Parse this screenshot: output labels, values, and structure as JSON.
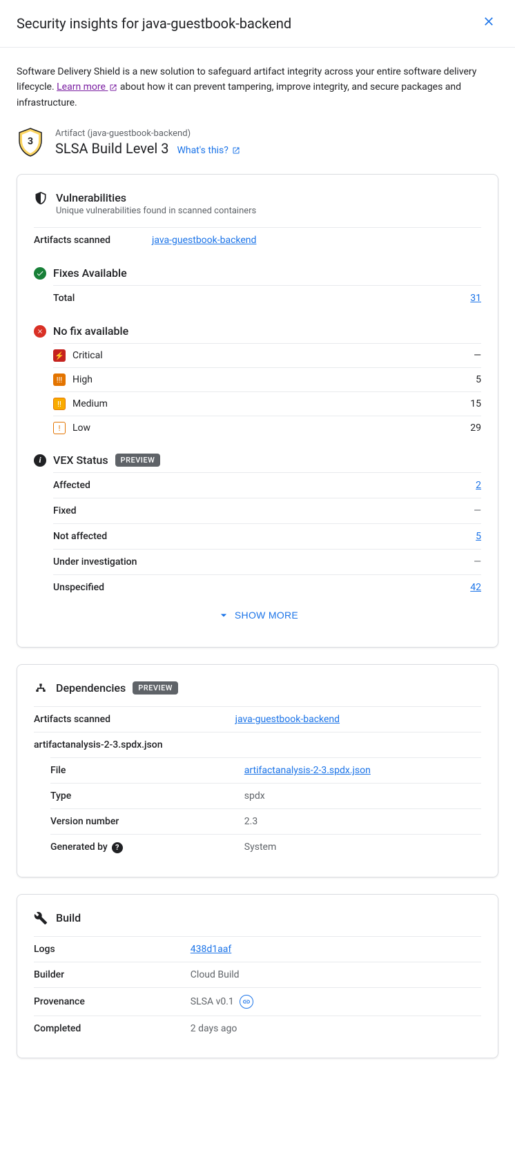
{
  "header": {
    "title": "Security insights for java-guestbook-backend"
  },
  "intro": {
    "text1": "Software Delivery Shield is a new solution to safeguard artifact integrity across your entire software delivery lifecycle. ",
    "learn": "Learn more",
    "text2": " about how it can prevent tampering, improve integrity, and secure packages and infrastructure."
  },
  "artifact": {
    "label": "Artifact (java-guestbook-backend)",
    "slsa": "SLSA Build Level 3",
    "whats_this": "What's this?",
    "badge_number": "3"
  },
  "vuln": {
    "title": "Vulnerabilities",
    "subtitle": "Unique vulnerabilities found in scanned containers",
    "scanned_label": "Artifacts scanned",
    "scanned_value": "java-guestbook-backend",
    "fixes": {
      "title": "Fixes Available",
      "total_label": "Total",
      "total_value": "31"
    },
    "nofix": {
      "title": "No fix available",
      "rows": [
        {
          "name": "Critical",
          "value": "—",
          "link": false
        },
        {
          "name": "High",
          "value": "5",
          "link": true
        },
        {
          "name": "Medium",
          "value": "15",
          "link": true
        },
        {
          "name": "Low",
          "value": "29",
          "link": true
        }
      ]
    },
    "vex": {
      "title": "VEX Status",
      "preview": "PREVIEW",
      "rows": [
        {
          "name": "Affected",
          "value": "2",
          "link": true
        },
        {
          "name": "Fixed",
          "value": "—",
          "link": false
        },
        {
          "name": "Not affected",
          "value": "5",
          "link": true
        },
        {
          "name": "Under investigation",
          "value": "—",
          "link": false
        },
        {
          "name": "Unspecified",
          "value": "42",
          "link": true
        }
      ]
    },
    "show_more": "SHOW MORE"
  },
  "deps": {
    "title": "Dependencies",
    "preview": "PREVIEW",
    "scanned_label": "Artifacts scanned",
    "scanned_value": "java-guestbook-backend",
    "file_group": "artifactanalysis-2-3.spdx.json",
    "rows": [
      {
        "k": "File",
        "v": "artifactanalysis-2-3.spdx.json",
        "link": true
      },
      {
        "k": "Type",
        "v": "spdx",
        "link": false
      },
      {
        "k": "Version number",
        "v": "2.3",
        "link": false
      },
      {
        "k": "Generated by",
        "v": "System",
        "link": false,
        "help": true
      }
    ]
  },
  "build": {
    "title": "Build",
    "rows": [
      {
        "k": "Logs",
        "v": "438d1aaf",
        "link": true
      },
      {
        "k": "Builder",
        "v": "Cloud Build",
        "link": false
      },
      {
        "k": "Provenance",
        "v": "SLSA v0.1",
        "link": false,
        "linkicon": true
      },
      {
        "k": "Completed",
        "v": "2 days ago",
        "link": false
      }
    ]
  }
}
